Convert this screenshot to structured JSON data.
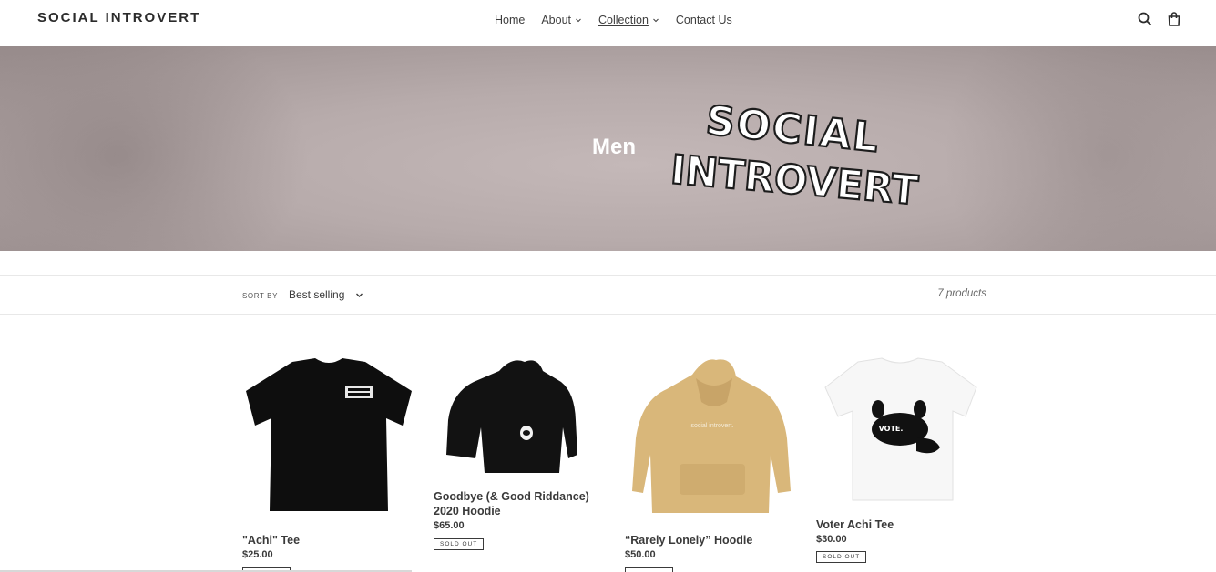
{
  "header": {
    "logo": "SOCIAL INTROVERT",
    "nav": [
      {
        "label": "Home",
        "has_dropdown": false,
        "active": false
      },
      {
        "label": "About",
        "has_dropdown": true,
        "active": false
      },
      {
        "label": "Collection",
        "has_dropdown": true,
        "active": true
      },
      {
        "label": "Contact Us",
        "has_dropdown": false,
        "active": false
      }
    ],
    "icons": [
      "search-icon",
      "cart-icon"
    ]
  },
  "hero": {
    "title": "Men",
    "graphic_line1": "SOCIAL",
    "graphic_line2": "INTROVERT"
  },
  "filter": {
    "sort_label": "SORT BY",
    "sort_value": "Best selling",
    "product_count": "7 products"
  },
  "products": [
    {
      "name": "\"Achi\" Tee",
      "price": "$25.00",
      "badge": ""
    },
    {
      "name": "Goodbye (& Good Riddance) 2020 Hoodie",
      "name_line1": "Goodbye (& Good Riddance)",
      "name_line2": "2020 Hoodie",
      "price": "$65.00",
      "badge": "SOLD OUT"
    },
    {
      "name": "“Rarely Lonely” Hoodie",
      "price": "$50.00",
      "badge": ""
    },
    {
      "name": "Voter Achi Tee",
      "price": "$30.00",
      "badge": "SOLD OUT",
      "print_text": "VOTE."
    }
  ],
  "colors": {
    "hero_bg": "#b7abab",
    "text": "#3a3a3a",
    "hoodie_tan": "#d9b77a"
  }
}
